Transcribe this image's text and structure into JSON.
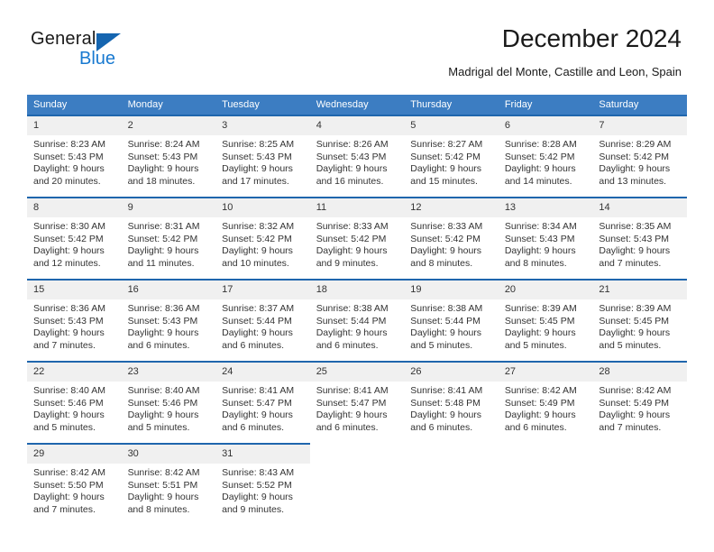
{
  "logo": {
    "word1": "General",
    "word2": "Blue",
    "triangle_color": "#1565b0",
    "blue_color": "#1879d0"
  },
  "header": {
    "title": "December 2024",
    "subtitle": "Madrigal del Monte, Castille and Leon, Spain"
  },
  "colors": {
    "header_blue": "#3c7dc2",
    "week_rule_blue": "#1f66ad",
    "daynum_band": "#f0f0f0",
    "text": "#333333"
  },
  "weekday_headers": [
    "Sunday",
    "Monday",
    "Tuesday",
    "Wednesday",
    "Thursday",
    "Friday",
    "Saturday"
  ],
  "weeks": [
    [
      {
        "day": "1",
        "sunrise": "Sunrise: 8:23 AM",
        "sunset": "Sunset: 5:43 PM",
        "daylight1": "Daylight: 9 hours",
        "daylight2": "and 20 minutes."
      },
      {
        "day": "2",
        "sunrise": "Sunrise: 8:24 AM",
        "sunset": "Sunset: 5:43 PM",
        "daylight1": "Daylight: 9 hours",
        "daylight2": "and 18 minutes."
      },
      {
        "day": "3",
        "sunrise": "Sunrise: 8:25 AM",
        "sunset": "Sunset: 5:43 PM",
        "daylight1": "Daylight: 9 hours",
        "daylight2": "and 17 minutes."
      },
      {
        "day": "4",
        "sunrise": "Sunrise: 8:26 AM",
        "sunset": "Sunset: 5:43 PM",
        "daylight1": "Daylight: 9 hours",
        "daylight2": "and 16 minutes."
      },
      {
        "day": "5",
        "sunrise": "Sunrise: 8:27 AM",
        "sunset": "Sunset: 5:42 PM",
        "daylight1": "Daylight: 9 hours",
        "daylight2": "and 15 minutes."
      },
      {
        "day": "6",
        "sunrise": "Sunrise: 8:28 AM",
        "sunset": "Sunset: 5:42 PM",
        "daylight1": "Daylight: 9 hours",
        "daylight2": "and 14 minutes."
      },
      {
        "day": "7",
        "sunrise": "Sunrise: 8:29 AM",
        "sunset": "Sunset: 5:42 PM",
        "daylight1": "Daylight: 9 hours",
        "daylight2": "and 13 minutes."
      }
    ],
    [
      {
        "day": "8",
        "sunrise": "Sunrise: 8:30 AM",
        "sunset": "Sunset: 5:42 PM",
        "daylight1": "Daylight: 9 hours",
        "daylight2": "and 12 minutes."
      },
      {
        "day": "9",
        "sunrise": "Sunrise: 8:31 AM",
        "sunset": "Sunset: 5:42 PM",
        "daylight1": "Daylight: 9 hours",
        "daylight2": "and 11 minutes."
      },
      {
        "day": "10",
        "sunrise": "Sunrise: 8:32 AM",
        "sunset": "Sunset: 5:42 PM",
        "daylight1": "Daylight: 9 hours",
        "daylight2": "and 10 minutes."
      },
      {
        "day": "11",
        "sunrise": "Sunrise: 8:33 AM",
        "sunset": "Sunset: 5:42 PM",
        "daylight1": "Daylight: 9 hours",
        "daylight2": "and 9 minutes."
      },
      {
        "day": "12",
        "sunrise": "Sunrise: 8:33 AM",
        "sunset": "Sunset: 5:42 PM",
        "daylight1": "Daylight: 9 hours",
        "daylight2": "and 8 minutes."
      },
      {
        "day": "13",
        "sunrise": "Sunrise: 8:34 AM",
        "sunset": "Sunset: 5:43 PM",
        "daylight1": "Daylight: 9 hours",
        "daylight2": "and 8 minutes."
      },
      {
        "day": "14",
        "sunrise": "Sunrise: 8:35 AM",
        "sunset": "Sunset: 5:43 PM",
        "daylight1": "Daylight: 9 hours",
        "daylight2": "and 7 minutes."
      }
    ],
    [
      {
        "day": "15",
        "sunrise": "Sunrise: 8:36 AM",
        "sunset": "Sunset: 5:43 PM",
        "daylight1": "Daylight: 9 hours",
        "daylight2": "and 7 minutes."
      },
      {
        "day": "16",
        "sunrise": "Sunrise: 8:36 AM",
        "sunset": "Sunset: 5:43 PM",
        "daylight1": "Daylight: 9 hours",
        "daylight2": "and 6 minutes."
      },
      {
        "day": "17",
        "sunrise": "Sunrise: 8:37 AM",
        "sunset": "Sunset: 5:44 PM",
        "daylight1": "Daylight: 9 hours",
        "daylight2": "and 6 minutes."
      },
      {
        "day": "18",
        "sunrise": "Sunrise: 8:38 AM",
        "sunset": "Sunset: 5:44 PM",
        "daylight1": "Daylight: 9 hours",
        "daylight2": "and 6 minutes."
      },
      {
        "day": "19",
        "sunrise": "Sunrise: 8:38 AM",
        "sunset": "Sunset: 5:44 PM",
        "daylight1": "Daylight: 9 hours",
        "daylight2": "and 5 minutes."
      },
      {
        "day": "20",
        "sunrise": "Sunrise: 8:39 AM",
        "sunset": "Sunset: 5:45 PM",
        "daylight1": "Daylight: 9 hours",
        "daylight2": "and 5 minutes."
      },
      {
        "day": "21",
        "sunrise": "Sunrise: 8:39 AM",
        "sunset": "Sunset: 5:45 PM",
        "daylight1": "Daylight: 9 hours",
        "daylight2": "and 5 minutes."
      }
    ],
    [
      {
        "day": "22",
        "sunrise": "Sunrise: 8:40 AM",
        "sunset": "Sunset: 5:46 PM",
        "daylight1": "Daylight: 9 hours",
        "daylight2": "and 5 minutes."
      },
      {
        "day": "23",
        "sunrise": "Sunrise: 8:40 AM",
        "sunset": "Sunset: 5:46 PM",
        "daylight1": "Daylight: 9 hours",
        "daylight2": "and 5 minutes."
      },
      {
        "day": "24",
        "sunrise": "Sunrise: 8:41 AM",
        "sunset": "Sunset: 5:47 PM",
        "daylight1": "Daylight: 9 hours",
        "daylight2": "and 6 minutes."
      },
      {
        "day": "25",
        "sunrise": "Sunrise: 8:41 AM",
        "sunset": "Sunset: 5:47 PM",
        "daylight1": "Daylight: 9 hours",
        "daylight2": "and 6 minutes."
      },
      {
        "day": "26",
        "sunrise": "Sunrise: 8:41 AM",
        "sunset": "Sunset: 5:48 PM",
        "daylight1": "Daylight: 9 hours",
        "daylight2": "and 6 minutes."
      },
      {
        "day": "27",
        "sunrise": "Sunrise: 8:42 AM",
        "sunset": "Sunset: 5:49 PM",
        "daylight1": "Daylight: 9 hours",
        "daylight2": "and 6 minutes."
      },
      {
        "day": "28",
        "sunrise": "Sunrise: 8:42 AM",
        "sunset": "Sunset: 5:49 PM",
        "daylight1": "Daylight: 9 hours",
        "daylight2": "and 7 minutes."
      }
    ],
    [
      {
        "day": "29",
        "sunrise": "Sunrise: 8:42 AM",
        "sunset": "Sunset: 5:50 PM",
        "daylight1": "Daylight: 9 hours",
        "daylight2": "and 7 minutes."
      },
      {
        "day": "30",
        "sunrise": "Sunrise: 8:42 AM",
        "sunset": "Sunset: 5:51 PM",
        "daylight1": "Daylight: 9 hours",
        "daylight2": "and 8 minutes."
      },
      {
        "day": "31",
        "sunrise": "Sunrise: 8:43 AM",
        "sunset": "Sunset: 5:52 PM",
        "daylight1": "Daylight: 9 hours",
        "daylight2": "and 9 minutes."
      },
      null,
      null,
      null,
      null
    ]
  ]
}
